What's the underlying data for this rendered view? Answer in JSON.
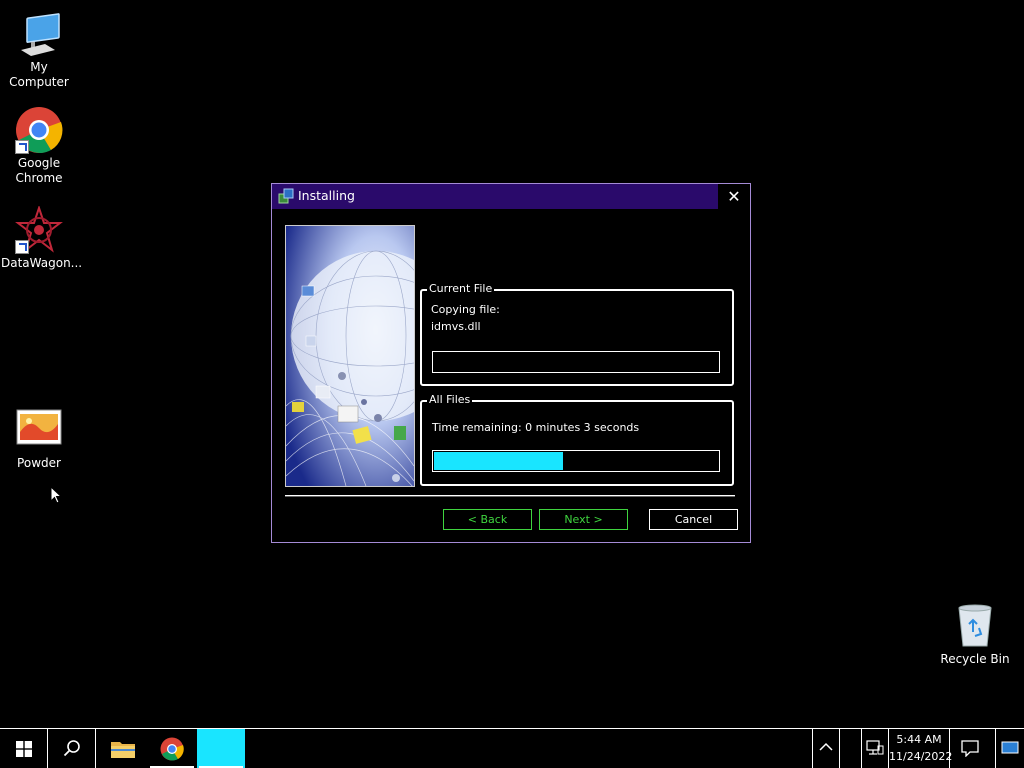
{
  "desktop": {
    "icons": [
      {
        "label": "My Computer",
        "icon": "computer-icon"
      },
      {
        "label": "Google Chrome",
        "icon": "chrome-icon"
      },
      {
        "label": "DataWagon...",
        "icon": "datawagon-icon"
      },
      {
        "label": "Powder",
        "icon": "powder-icon"
      },
      {
        "label": "Recycle Bin",
        "icon": "recycle-bin-icon"
      }
    ]
  },
  "dialog": {
    "title": "Installing",
    "close_glyph": "✕",
    "current_file": {
      "legend": "Current File",
      "line1": "Copying file:",
      "line2": "idmvs.dll",
      "progress": 0
    },
    "all_files": {
      "legend": "All Files",
      "time_remaining": "Time remaining: 0 minutes 3 seconds",
      "progress": 0.45
    },
    "buttons": {
      "back": "< Back",
      "next": "Next >",
      "cancel": "Cancel"
    }
  },
  "taskbar": {
    "time": "5:44 AM",
    "date": "11/24/2022",
    "apps": [
      "start-icon",
      "search-icon",
      "file-explorer-icon",
      "chrome-icon",
      "installer-app"
    ]
  },
  "colors": {
    "titlebar": "#2a0a6b",
    "accent_cyan": "#19e5ff",
    "button_green": "#3fd43f"
  }
}
